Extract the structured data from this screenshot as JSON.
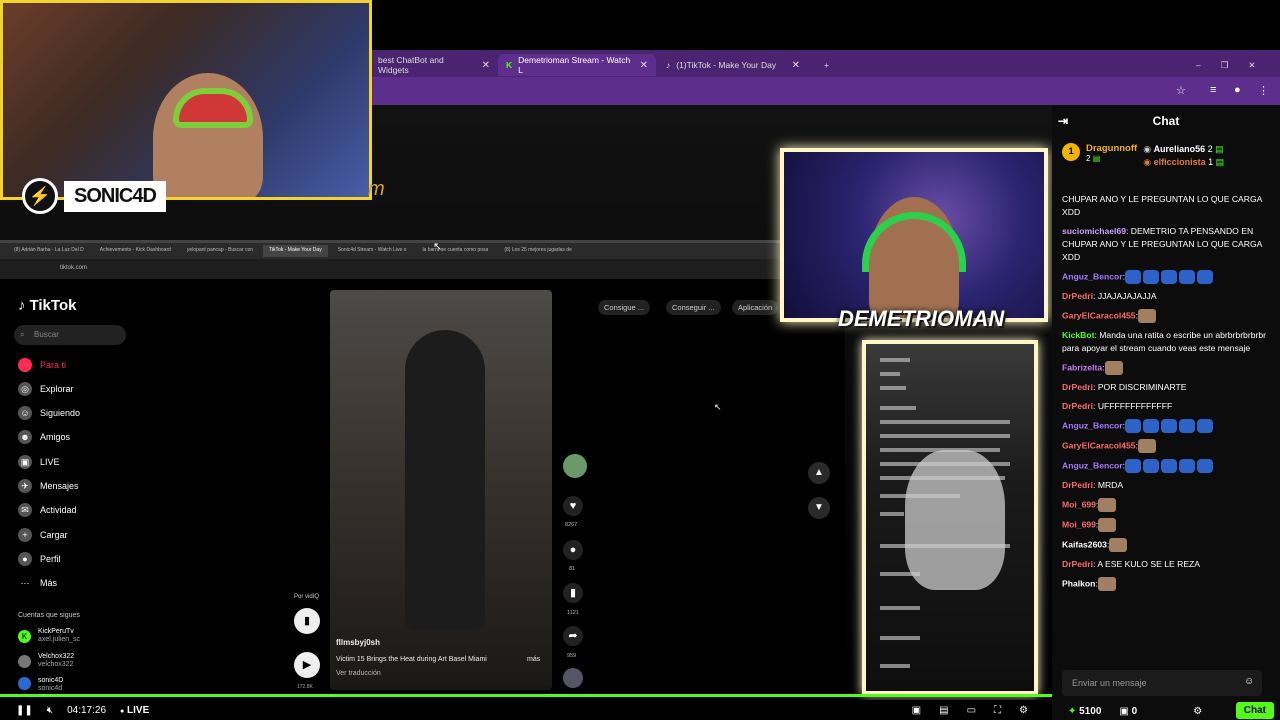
{
  "browser": {
    "tabs": [
      {
        "label": "best ChatBot and Widgets",
        "active": false
      },
      {
        "label": "Demetrioman Stream - Watch L",
        "active": true
      },
      {
        "label": "(1)TikTok - Make Your Day",
        "active": false
      }
    ],
    "new_tab": "+"
  },
  "streamer": {
    "name": "SONIC4D",
    "text": "m"
  },
  "inner_browser": {
    "tabs": [
      "(8) Adrián Barba - La Luz Del D",
      "Achievements - Kick Dashboard",
      "yelopant pancap - Buscar con",
      "TikTok - Make Your Day",
      "Sonic4d Stream - Watch Live o",
      "la barra se cuenta como posa",
      "(8) Los 25 mejores jugadas de"
    ],
    "url": "tiktok.com"
  },
  "tiktok": {
    "logo": "TikTok",
    "search_placeholder": "Buscar",
    "nav": [
      "Para ti",
      "Explorar",
      "Siguiendo",
      "Amigos",
      "LIVE",
      "Mensajes",
      "Actividad",
      "Cargar",
      "Perfil",
      "Más"
    ],
    "following_header": "Cuentas que sigues",
    "following": [
      {
        "name": "KickPeruTv",
        "handle": "axel.julien_sc"
      },
      {
        "name": "Velchox322",
        "handle": "velchox322"
      },
      {
        "name": "sonic4D",
        "handle": "sonic4d"
      }
    ],
    "pills": [
      "Consigue ...",
      "Conseguir ...",
      "Aplicación"
    ],
    "video": {
      "user": "fllmsbyj0sh",
      "caption": "Victim 15 Brings the Heat during Art Basel Miami",
      "more": "más",
      "translate": "Ver traducción",
      "ad_label": "Por vidIQ",
      "count_small": "172.8K"
    },
    "counts": [
      "8267",
      "81",
      "1121",
      "959"
    ]
  },
  "cam2_label": "DEMETRIOMAN",
  "player": {
    "time": "04:17:26",
    "live": "LIVE"
  },
  "chat": {
    "title": "Chat",
    "gifters": [
      {
        "rank": "1",
        "name": "Dragunnoff",
        "count": "2"
      },
      {
        "rank": "2",
        "name": "Aureliano56",
        "count": "2"
      },
      {
        "rank": "3",
        "name": "elficcionista",
        "count": "1"
      }
    ],
    "messages": [
      {
        "user": "",
        "text": "CHUPAR ANO Y LE PREGUNTAN LO QUE CARGA XDD",
        "color": "#fff"
      },
      {
        "user": "suciomichael69",
        "text": ": DEMETRIO TA PENSANDO EN CHUPAR ANO Y LE PREGUNTAN LO QUE CARGA XDD",
        "color": "#c7a4ff"
      },
      {
        "user": "Anguz_Bencor",
        "text": ":",
        "color": "#a678ff",
        "emotes": 5
      },
      {
        "user": "DrPedri",
        "text": ": JJAJAJAJAJJA",
        "color": "#ff6b6b"
      },
      {
        "user": "GaryElCaracol455",
        "text": ":",
        "color": "#ff6b6b",
        "emotes2": 1
      },
      {
        "user": "KickBot",
        "text": ": Manda una ratita o escribe un abrbrbrbrbrbr para apoyar el stream cuando veas este mensaje",
        "color": "#53fc18"
      },
      {
        "user": "Fabrizelta",
        "text": ":",
        "color": "#c77dff",
        "emotes2": 1
      },
      {
        "user": "DrPedri",
        "text": ": POR DISCRIMINARTE",
        "color": "#ff6b6b"
      },
      {
        "user": "DrPedri",
        "text": ": UFFFFFFFFFFFFF",
        "color": "#ff6b6b"
      },
      {
        "user": "Anguz_Bencor",
        "text": ":",
        "color": "#a678ff",
        "emotes": 5
      },
      {
        "user": "GaryElCaracol455",
        "text": ":",
        "color": "#ff6b6b",
        "emotes2": 1
      },
      {
        "user": "Anguz_Bencor",
        "text": ":",
        "color": "#a678ff",
        "emotes": 5
      },
      {
        "user": "DrPedri",
        "text": ": MRDA",
        "color": "#ff6b6b"
      },
      {
        "user": "Moi_699",
        "text": ":",
        "color": "#ff6b6b",
        "emotes2": 1
      },
      {
        "user": "Moi_699",
        "text": ":",
        "color": "#ff6b6b",
        "emotes2": 1
      },
      {
        "user": "Kaifas2603",
        "text": ":",
        "color": "#fff",
        "emotes2": 1
      },
      {
        "user": "DrPedri",
        "text": ": A ESE KULO SE LE REZA",
        "color": "#ff6b6b"
      },
      {
        "user": "Phalkon",
        "text": ":",
        "color": "#fff",
        "emotes2": 1
      }
    ],
    "input_placeholder": "Enviar un mensaje",
    "points": "5100",
    "zero": "0",
    "send_label": "Chat"
  }
}
